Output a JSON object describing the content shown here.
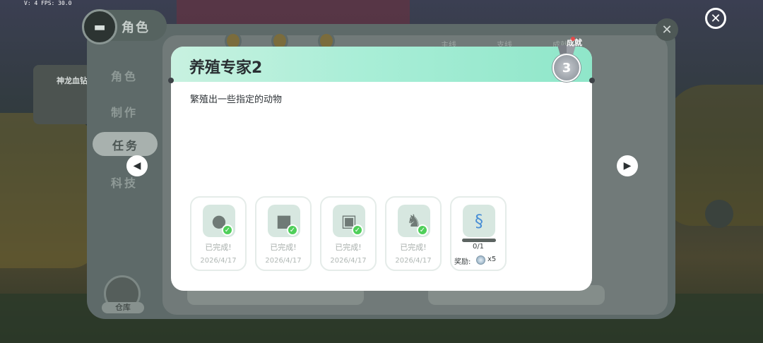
{
  "hud": {
    "fps_text": "V: 4 FPS: 30.0"
  },
  "background_panel": {
    "role_tab_label": "角色",
    "sidebar": [
      "角色",
      "制作",
      "任务",
      "科技"
    ],
    "active_item": "任务",
    "tabs": [
      "主线",
      "支线",
      "成就"
    ],
    "warehouse_label": "仓库",
    "quest_title": "神龙血钻"
  },
  "modal": {
    "title": "养殖专家2",
    "description": "繁殖出一些指定的动物",
    "medal_level": "3",
    "medal_badge": "成就",
    "tasks": [
      {
        "icon": "penguin-icon",
        "status": "已完成!",
        "date": "2026/4/17"
      },
      {
        "icon": "polar-bear-icon",
        "status": "已完成!",
        "date": "2026/4/17"
      },
      {
        "icon": "cow-icon",
        "status": "已完成!",
        "date": "2026/4/17"
      },
      {
        "icon": "rabbit-icon",
        "status": "已完成!",
        "date": "2026/4/17"
      },
      {
        "icon": "seahorse-icon",
        "progress": "0/1",
        "reward_label": "奖励:",
        "reward_icon": "silver-coin-icon",
        "reward_count": "x5"
      }
    ]
  },
  "colors": {
    "header_gradient_start": "#c8f1e0",
    "header_gradient_end": "#8fe6c9",
    "check_green": "#4fcf5a"
  }
}
